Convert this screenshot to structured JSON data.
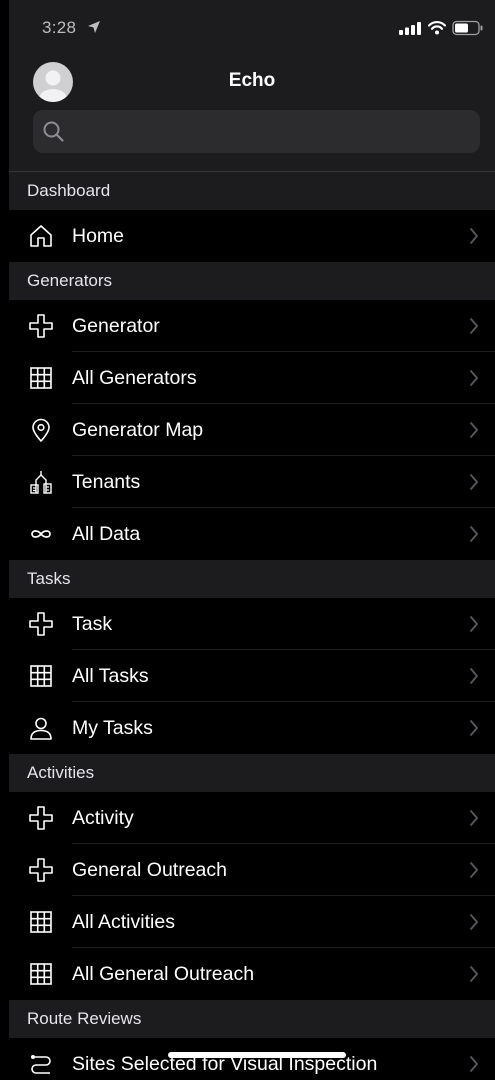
{
  "status_bar": {
    "time": "3:28",
    "icons": [
      "location-arrow-icon",
      "cellular-signal-icon",
      "wifi-icon",
      "battery-icon"
    ]
  },
  "header": {
    "title": "Echo",
    "search_placeholder": ""
  },
  "sections": [
    {
      "title": "Dashboard",
      "items": [
        {
          "label": "Home",
          "icon": "home-icon"
        }
      ]
    },
    {
      "title": "Generators",
      "items": [
        {
          "label": "Generator",
          "icon": "plus-icon"
        },
        {
          "label": "All Generators",
          "icon": "grid-icon"
        },
        {
          "label": "Generator Map",
          "icon": "map-pin-icon"
        },
        {
          "label": "Tenants",
          "icon": "buildings-icon"
        },
        {
          "label": "All Data",
          "icon": "infinity-icon"
        }
      ]
    },
    {
      "title": "Tasks",
      "items": [
        {
          "label": "Task",
          "icon": "plus-icon"
        },
        {
          "label": "All Tasks",
          "icon": "grid-icon"
        },
        {
          "label": "My Tasks",
          "icon": "person-icon"
        }
      ]
    },
    {
      "title": "Activities",
      "items": [
        {
          "label": "Activity",
          "icon": "plus-icon"
        },
        {
          "label": "General Outreach",
          "icon": "plus-icon"
        },
        {
          "label": "All Activities",
          "icon": "grid-icon"
        },
        {
          "label": "All General Outreach",
          "icon": "grid-icon"
        }
      ]
    },
    {
      "title": "Route Reviews",
      "items": [
        {
          "label": "Sites Selected for Visual Inspection",
          "icon": "route-icon"
        }
      ]
    }
  ],
  "colors": {
    "background": "#1c1c1e",
    "row_background": "#000000",
    "search_background": "#2c2c2e",
    "chevron": "#5a5a5e"
  }
}
